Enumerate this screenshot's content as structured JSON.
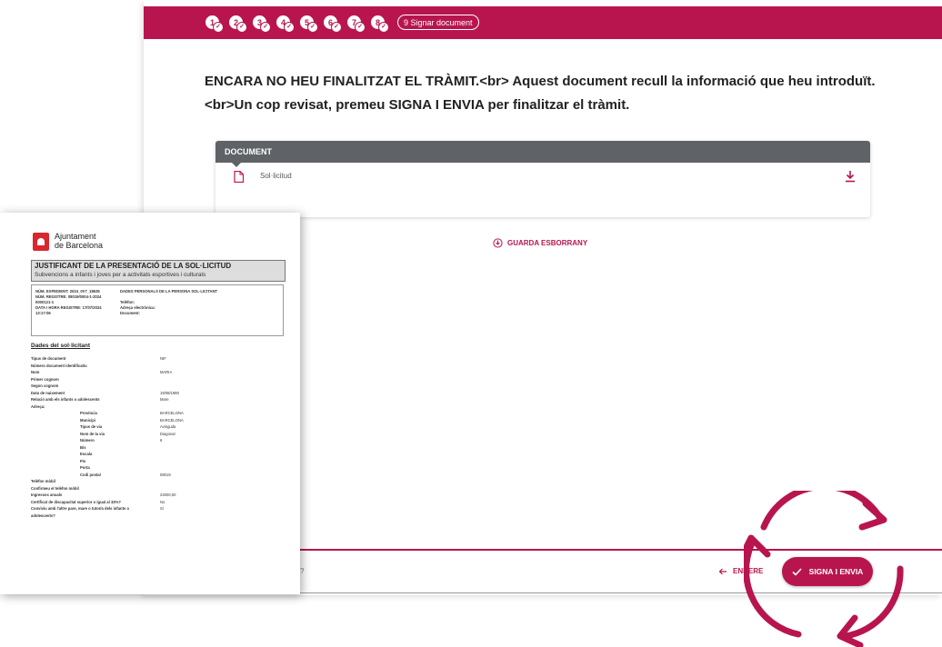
{
  "app": {
    "steps": [
      "1",
      "2",
      "3",
      "4",
      "5",
      "6",
      "7",
      "8"
    ],
    "current_step": "9 Signar document",
    "intro_line1": "ENCARA NO HEU FINALITZAT EL TRÀMIT.<br> Aquest document recull la informació que heu introduït.",
    "intro_line2": "<br>Un cop revisat, premeu SIGNA I ENVIA per finalitzar el tràmit.",
    "document_header": "DOCUMENT",
    "document_item": "Sol·licitud",
    "save_draft": "GUARDA ESBORRANY",
    "back_label": "ENRERE",
    "sign_label": "SIGNA I ENVIA",
    "footer_partial": "?"
  },
  "colors": {
    "accent": "#b8154f",
    "header_gray": "#5f6266"
  },
  "icons": [
    "check-icon",
    "document-icon",
    "download-icon",
    "save-icon",
    "arrow-left-icon",
    "recycle-arrows-icon"
  ],
  "paper": {
    "org_line1": "Ajuntament",
    "org_line2": "de Barcelona",
    "title": "JUSTIFICANT DE LA PRESENTACIÓ DE LA SOL·LICITUD",
    "subtitle": "Subvencions a infants i joves per a activitats esportives i culturals",
    "info_left": [
      "NÚM. EXPEDIENT: 2024_0V7_18635",
      "NÚM. REGISTRE: 08019/0004-1-2024",
      "0000121-1",
      "DATA I HORA REGISTRE: 17/07/2024",
      "13:17:06"
    ],
    "info_right": [
      "DADES PERSONALS DE LA PERSONA SOL·LICITANT",
      "",
      "Telèfon:",
      "Adreça electrònica:",
      "Document:"
    ],
    "section": "Dades del sol·licitant",
    "rows": [
      {
        "k": "Tipus de document",
        "v": "NIF"
      },
      {
        "k": "Número document identificatiu",
        "v": ""
      },
      {
        "k": "Nom",
        "v": "MARIA"
      },
      {
        "k": "Primer cognom",
        "v": ""
      },
      {
        "k": "Segon cognom",
        "v": ""
      },
      {
        "k": "Data de naixement",
        "v": "19/08/1980"
      },
      {
        "k": "Relació amb els infants o adolescents",
        "v": "Mare"
      },
      {
        "k": "Adreça:",
        "v": ""
      },
      {
        "k": "Província",
        "v": "BARCELONA",
        "sub": true
      },
      {
        "k": "Municipi",
        "v": "BARCELONA",
        "sub": true
      },
      {
        "k": "Tipus de via",
        "v": "Avinguda",
        "sub": true
      },
      {
        "k": "Nom de la via",
        "v": "Diagonal",
        "sub": true
      },
      {
        "k": "Número",
        "v": "6",
        "sub": true
      },
      {
        "k": "Bis",
        "v": "",
        "sub": true
      },
      {
        "k": "Escala",
        "v": "",
        "sub": true
      },
      {
        "k": "Pis",
        "v": "",
        "sub": true
      },
      {
        "k": "Porta",
        "v": "",
        "sub": true
      },
      {
        "k": "Codi postal",
        "v": "08019",
        "sub": true
      },
      {
        "k": "Telèfon mòbil",
        "v": ""
      },
      {
        "k": "Confirmeu el telèfon mòbil",
        "v": ""
      },
      {
        "k": "Ingressos anuals",
        "v": "24000,00"
      },
      {
        "k": "Certificat de discapacitat superior o igual al 33%?",
        "v": "No"
      },
      {
        "k": "Conviviu amb l'altre pare, mare o tutor/a dels infants o",
        "v": "Sí"
      },
      {
        "k": "adolescents?",
        "v": ""
      }
    ]
  }
}
